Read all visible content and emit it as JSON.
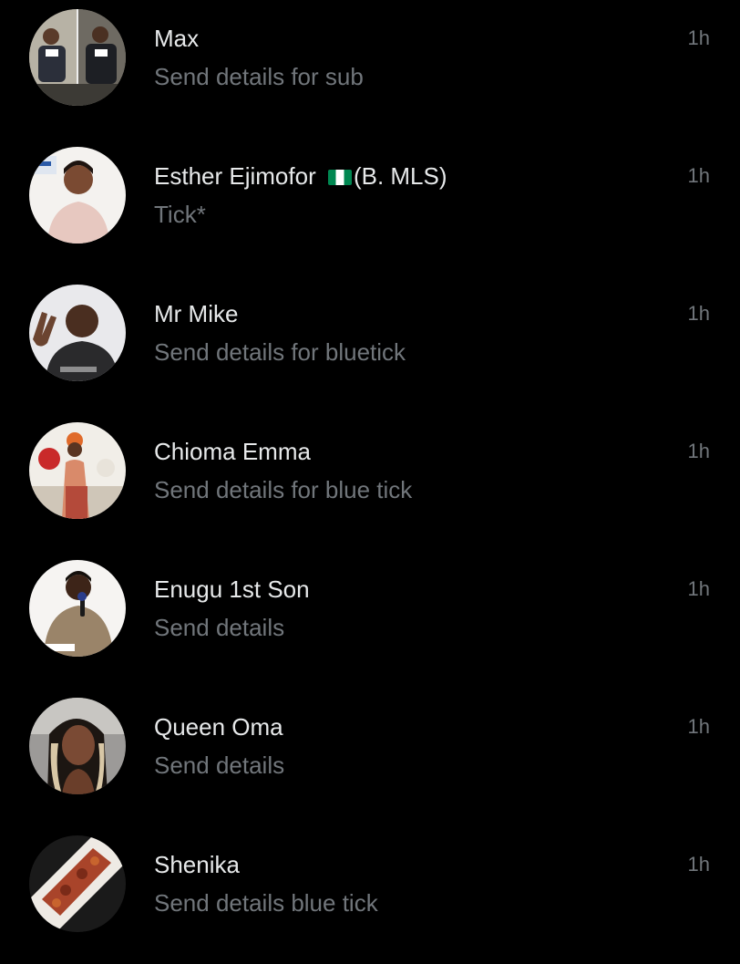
{
  "colors": {
    "background": "#000000",
    "name_text": "#e7e9ea",
    "secondary_text": "#71767b"
  },
  "conversations": [
    {
      "name": "Max",
      "flag": "",
      "name_suffix": "",
      "message": "Send details for sub",
      "time": "1h",
      "avatar_icon": "graduation-photo-avatar"
    },
    {
      "name": "Esther Ejimofor ",
      "flag": "nigeria-flag-icon",
      "name_suffix": "(B. MLS)",
      "message": "Tick*",
      "time": "1h",
      "avatar_icon": "woman-portrait-avatar"
    },
    {
      "name": "Mr Mike",
      "flag": "",
      "name_suffix": "",
      "message": "Send details for bluetick",
      "time": "1h",
      "avatar_icon": "man-peace-sign-avatar"
    },
    {
      "name": "Chioma Emma",
      "flag": "",
      "name_suffix": "",
      "message": "Send details for blue tick",
      "time": "1h",
      "avatar_icon": "woman-traditional-attire-avatar"
    },
    {
      "name": "Enugu 1st Son",
      "flag": "",
      "name_suffix": "",
      "message": "Send details",
      "time": "1h",
      "avatar_icon": "man-microphone-avatar"
    },
    {
      "name": "Queen Oma",
      "flag": "",
      "name_suffix": "",
      "message": "Send details",
      "time": "1h",
      "avatar_icon": "woman-selfie-avatar"
    },
    {
      "name": "Shenika",
      "flag": "",
      "name_suffix": "",
      "message": "Send details blue tick",
      "time": "1h",
      "avatar_icon": "food-plate-avatar"
    }
  ]
}
